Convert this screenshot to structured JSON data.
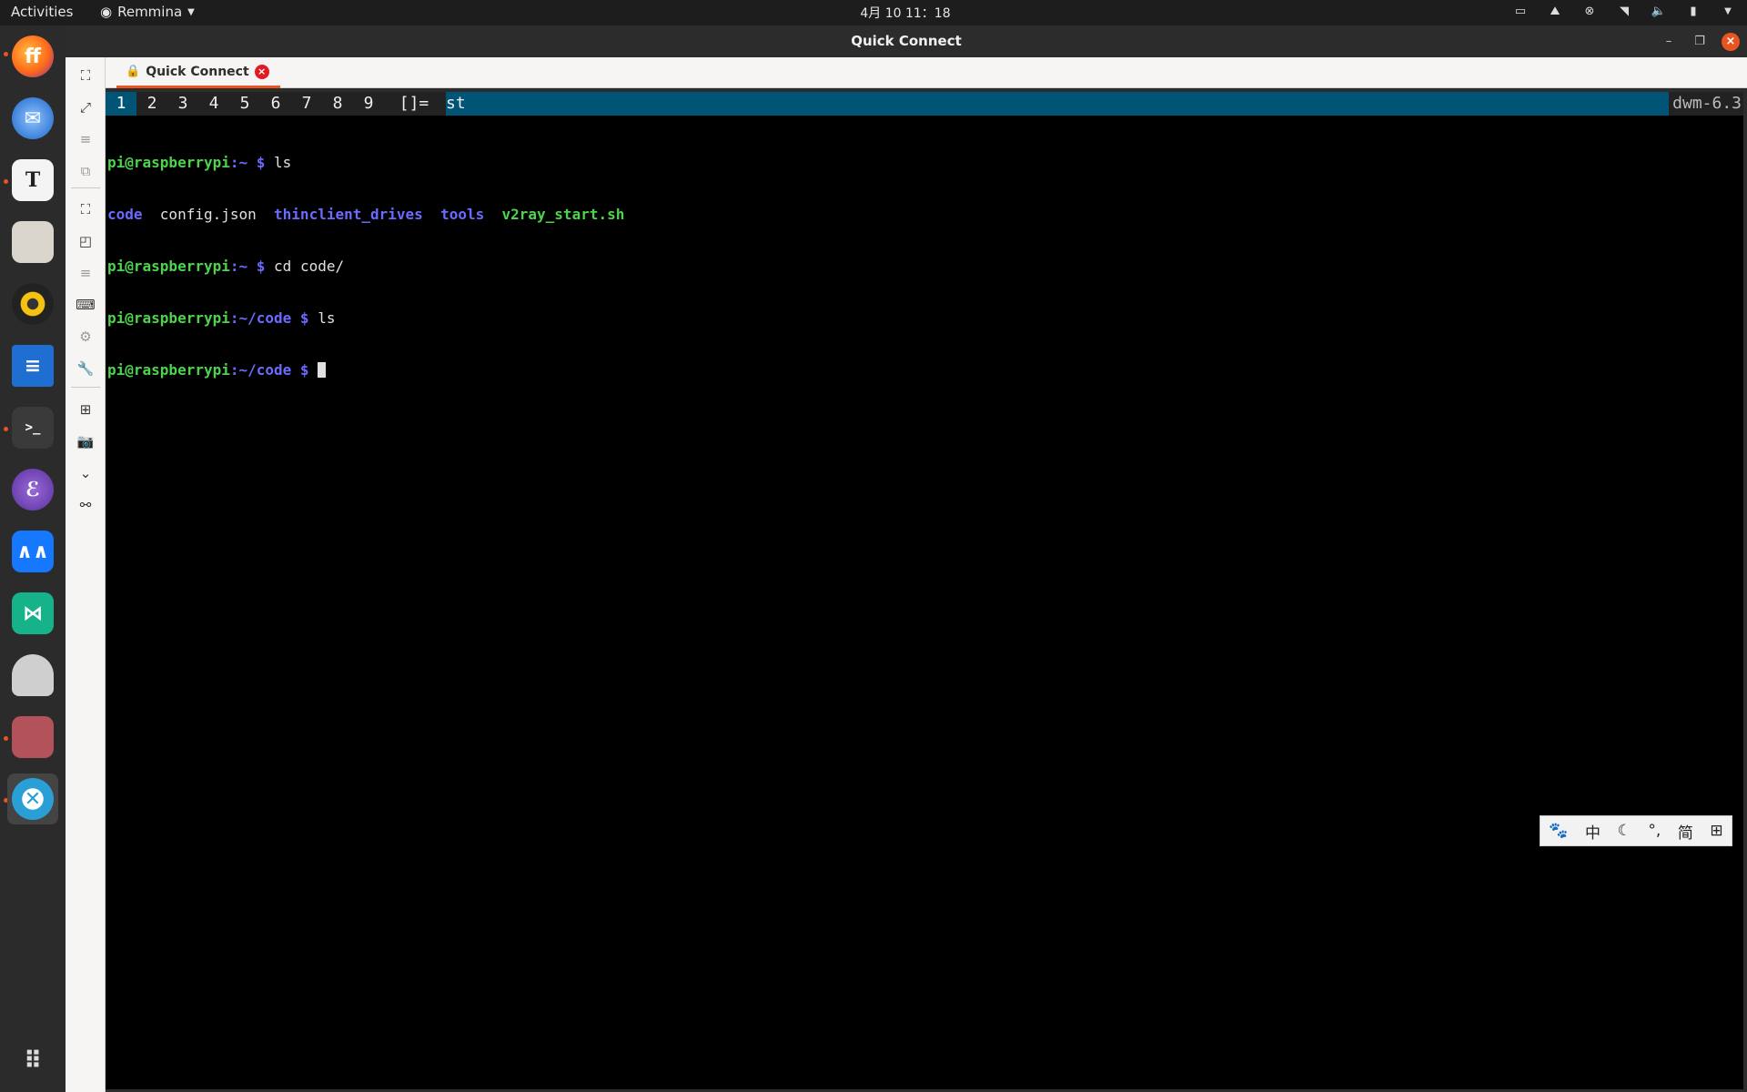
{
  "topbar": {
    "activities": "Activities",
    "app_menu": "Remmina",
    "clock": "4月 10 11：18"
  },
  "window": {
    "title": "Quick Connect",
    "tab_label": "Quick Connect"
  },
  "dwm": {
    "tags": [
      "1",
      "2",
      "3",
      "4",
      "5",
      "6",
      "7",
      "8",
      "9"
    ],
    "selected_tag": "1",
    "layout_symbol": "[]=",
    "window_title": "st",
    "status": "dwm-6.3"
  },
  "terminal": {
    "prompt_user": "pi@raspberrypi",
    "line1": {
      "path": "~",
      "cmd": "ls"
    },
    "ls_output": {
      "code": "code",
      "config": "config.json",
      "thinclient": "thinclient_drives",
      "tools": "tools",
      "v2ray": "v2ray_start.sh"
    },
    "line3": {
      "path": "~",
      "cmd": "cd code/"
    },
    "line4": {
      "path": "~/code",
      "cmd": "ls"
    },
    "line5": {
      "path": "~/code",
      "cmd": ""
    }
  },
  "ime": {
    "lang": "中",
    "punct": "°,",
    "charset": "简"
  },
  "colors": {
    "accent": "#e95420",
    "dwm_sel": "#005577",
    "prompt_green": "#4cd44c",
    "prompt_blue": "#6a6aff"
  }
}
